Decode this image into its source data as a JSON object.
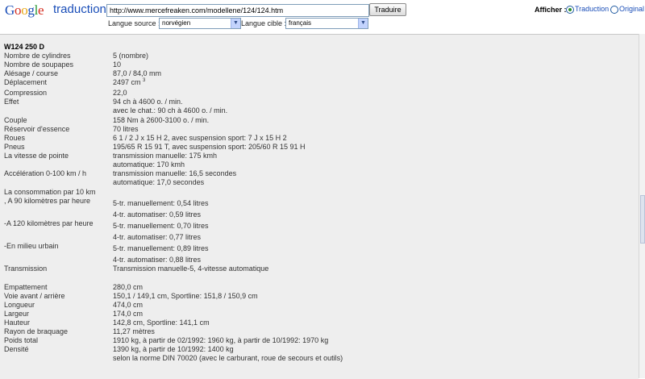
{
  "header": {
    "logo_google": "Google",
    "logo_sub": "traduction",
    "url_value": "http://www.mercefreaken.com/modellene/124/124.htm",
    "translate_button": "Traduire",
    "source_label": "Langue source :",
    "source_value": "norvégien",
    "target_label": "Langue cible :",
    "target_value": "français",
    "display_label": "Afficher :",
    "option_translation": "Traduction",
    "option_original": "Original"
  },
  "content": {
    "model": "W124 250 D",
    "rows": [
      {
        "label": "Nombre de cylindres",
        "value": "5 (nombre)"
      },
      {
        "label": "Nombre de soupapes",
        "value": "10"
      },
      {
        "label": "Alésage / course",
        "value": "87,0 / 84,0 mm"
      },
      {
        "label": "Déplacement",
        "value": "2497 cm"
      },
      {
        "label": "Compression",
        "value": "22,0"
      },
      {
        "label": "Effet",
        "value": "94 ch à 4600 o. / min."
      },
      {
        "label": "",
        "value": "avec le chat.: 90 ch à 4600 o. / min."
      },
      {
        "label": "Couple",
        "value": "158 Nm à 2600-3100 o. / min."
      },
      {
        "label": "Réservoir d'essence",
        "value": "70 litres"
      },
      {
        "label": "Roues",
        "value": "6 1 / 2 J x 15 H 2, avec suspension sport: 7 J x 15 H 2"
      },
      {
        "label": "Pneus",
        "value": "195/65 R 15 91 T, avec suspension sport: 205/60 R 15 91 H"
      },
      {
        "label": "La vitesse de pointe",
        "value": "transmission manuelle: 175 kmh"
      },
      {
        "label": "",
        "value": "automatique: 170 kmh"
      },
      {
        "label": "Accélération 0-100 km / h",
        "value": "transmission manuelle: 16,5 secondes"
      },
      {
        "label": "",
        "value": "automatique: 17,0 secondes"
      },
      {
        "label": "La consommation par 10 km",
        "value": ""
      },
      {
        "label": ", A 90 kilomètres par heure",
        "value": "5-tr. manuellement: 0,54 litres"
      },
      {
        "label": "",
        "value": "4-tr. automatiser: 0,59 litres"
      },
      {
        "label": "-A 120 kilomètres par heure",
        "value": "5-tr. manuellement: 0,70 litres"
      },
      {
        "label": "",
        "value": "4-tr. automatiser: 0,77 litres"
      },
      {
        "label": "-En milieu urbain",
        "value": "5-tr. manuellement: 0,89 litres"
      },
      {
        "label": "",
        "value": "4-tr. automatiser: 0,88 litres"
      },
      {
        "label": "Transmission",
        "value": "Transmission manuelle-5, 4-vitesse automatique"
      },
      {
        "label": "Empattement",
        "value": "280,0 cm"
      },
      {
        "label": "Voie avant / arrière",
        "value": "150,1 / 149,1 cm, Sportline: 151,8 / 150,9 cm"
      },
      {
        "label": "Longueur",
        "value": "474,0 cm"
      },
      {
        "label": "Largeur",
        "value": "174,0 cm"
      },
      {
        "label": "Hauteur",
        "value": "142,8 cm, Sportline: 141,1 cm"
      },
      {
        "label": "Rayon de braquage",
        "value": "11,27 mètres"
      },
      {
        "label": "Poids total",
        "value": "1910 kg, à partir de 02/1992: 1960 kg, à partir de 10/1992: 1970 kg"
      },
      {
        "label": "Densité",
        "value": "1390 kg, à partir de 10/1992: 1400 kg"
      },
      {
        "label": "",
        "value": "selon la norme DIN 70020 (avec le carburant, roue de secours et outils)"
      }
    ],
    "displacement_sup": "3"
  }
}
